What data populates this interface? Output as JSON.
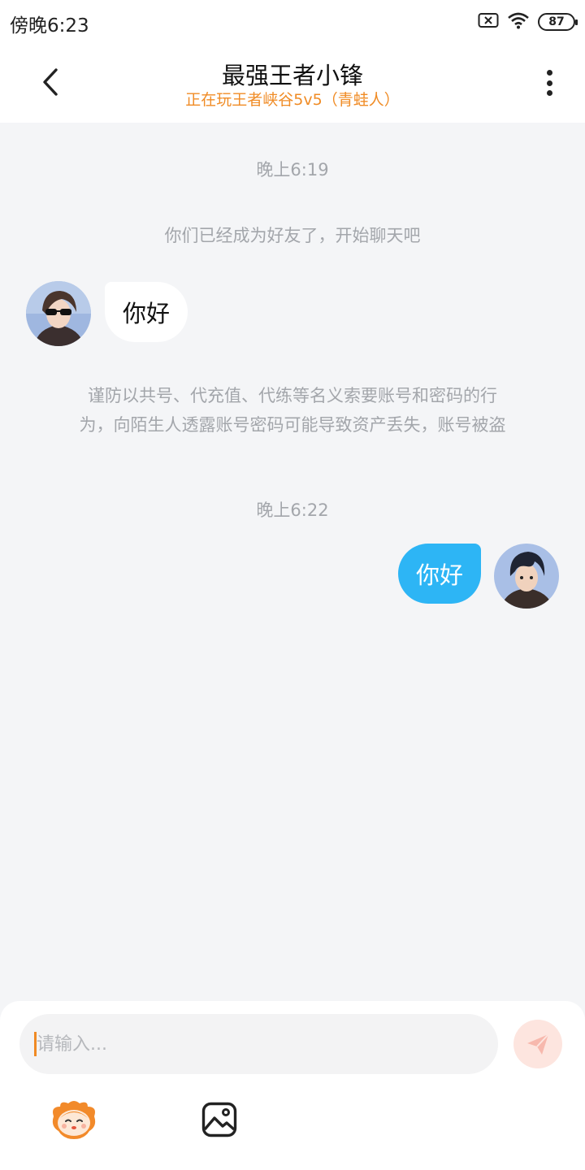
{
  "status_bar": {
    "time": "傍晚6:23",
    "battery": "87",
    "icons": [
      "sim-x-icon",
      "wifi-icon",
      "battery-icon"
    ]
  },
  "header": {
    "title": "最强王者小锋",
    "subtitle": "正在玩王者峡谷5v5（青蛙人）",
    "subtitle_color": "#f08c26"
  },
  "chat": {
    "time_1": "晚上6:19",
    "system_friend": "你们已经成为好友了，开始聊天吧",
    "incoming_message": "你好",
    "warning_line_1": "谨防以共号、代充值、代练等名义索要账号和密码的行",
    "warning_line_2": "为，向陌生人透露账号密码可能导致资产丢失，账号被盗",
    "time_2": "晚上6:22",
    "outgoing_message": "你好",
    "outgoing_bubble_color": "#2db5f5"
  },
  "composer": {
    "placeholder": "请输入...",
    "value": ""
  }
}
